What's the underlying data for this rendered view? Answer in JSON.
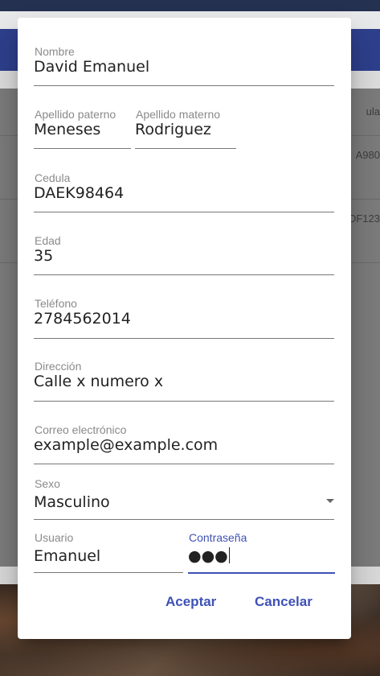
{
  "background": {
    "table_cells": [
      "ula",
      "A980",
      "DF123"
    ]
  },
  "form": {
    "nombre": {
      "label": "Nombre",
      "value": "David Emanuel"
    },
    "apellido_paterno": {
      "label": "Apellido paterno",
      "value": "Meneses"
    },
    "apellido_materno": {
      "label": "Apellido materno",
      "value": "Rodriguez"
    },
    "cedula": {
      "label": "Cedula",
      "value": "DAEK98464"
    },
    "edad": {
      "label": "Edad",
      "value": "35"
    },
    "telefono": {
      "label": "Teléfono",
      "value": "2784562014"
    },
    "direccion": {
      "label": "Dirección",
      "value": "Calle x numero x"
    },
    "correo": {
      "label": "Correo electrónico",
      "value": "example@example.com"
    },
    "sexo": {
      "label": "Sexo",
      "value": "Masculino"
    },
    "usuario": {
      "label": "Usuario",
      "value": "Emanuel"
    },
    "contrasena": {
      "label": "Contraseña",
      "value": "●●●"
    }
  },
  "actions": {
    "accept_label": "Aceptar",
    "cancel_label": "Cancelar"
  },
  "colors": {
    "accent": "#3f51b5",
    "app_bar": "#2e3f8c"
  }
}
